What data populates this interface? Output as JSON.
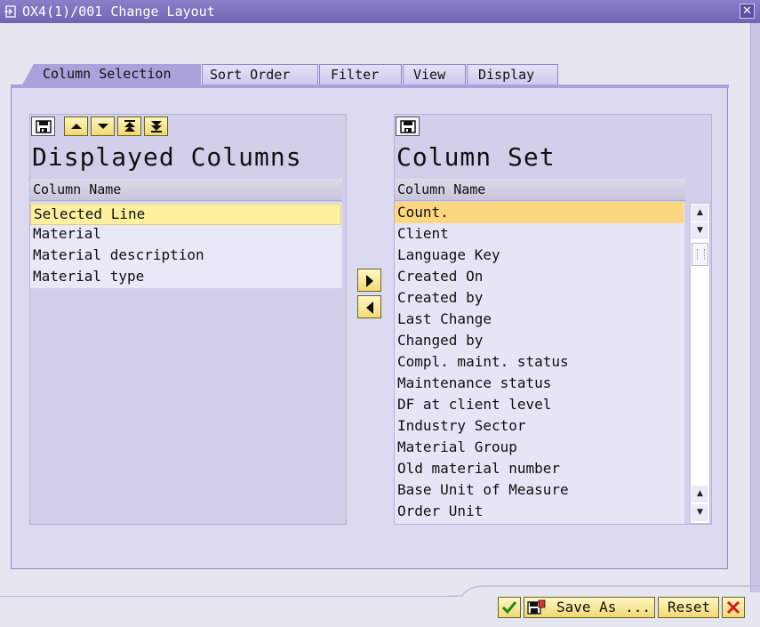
{
  "window": {
    "title": "OX4(1)/001 Change Layout"
  },
  "tabs": [
    {
      "label": "Column Selection",
      "active": true
    },
    {
      "label": "Sort Order",
      "active": false
    },
    {
      "label": "Filter",
      "active": false
    },
    {
      "label": "View",
      "active": false
    },
    {
      "label": "Display",
      "active": false
    }
  ],
  "left_panel": {
    "heading": "Displayed Columns",
    "column_header": "Column Name",
    "toolbar_icons": [
      "save-icon",
      "move-up-icon",
      "move-down-icon",
      "move-top-icon",
      "move-bottom-icon"
    ],
    "rows": [
      "Selected Line",
      "Material",
      "Material description",
      "Material type"
    ],
    "selected_row": "Selected Line"
  },
  "right_panel": {
    "heading": "Column Set",
    "column_header": "Column Name",
    "toolbar_icons": [
      "save-icon"
    ],
    "rows": [
      "Count.",
      "Client",
      "Language Key",
      "Created On",
      "Created by",
      "Last Change",
      "Changed by",
      "Compl. maint. status",
      "Maintenance status",
      "DF at client level",
      "Industry Sector",
      "Material Group",
      "Old material number",
      "Base Unit of Measure",
      "Order Unit"
    ],
    "focused_row": "Count."
  },
  "transfer_buttons": [
    "arrow-right-icon",
    "arrow-left-icon"
  ],
  "footer": {
    "save_as_label": "Save As ...",
    "reset_label": "Reset",
    "icons": [
      "checkmark-icon",
      "save-as-icon",
      "cancel-icon"
    ]
  },
  "colors": {
    "title_bar": "#6e64b2",
    "active_tab": "#a9a3dc",
    "selected_row": "#fff0a0",
    "focused_row": "#fdd680",
    "button": "#f0d874"
  }
}
